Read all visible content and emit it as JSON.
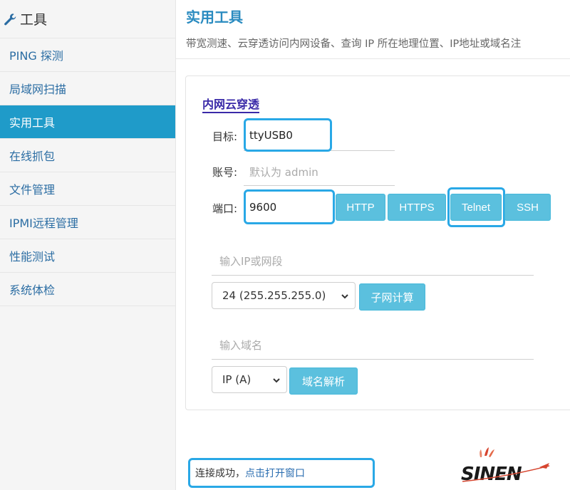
{
  "sidebar": {
    "header": "工具",
    "items": [
      {
        "label": "PING 探测"
      },
      {
        "label": "局域网扫描"
      },
      {
        "label": "实用工具"
      },
      {
        "label": "在线抓包"
      },
      {
        "label": "文件管理"
      },
      {
        "label": "IPMI远程管理"
      },
      {
        "label": "性能测试"
      },
      {
        "label": "系统体检"
      }
    ],
    "active_index": 2
  },
  "page": {
    "title": "实用工具",
    "description": "带宽测速、云穿透访问内网设备、查询 IP 所在地理位置、IP地址或域名注"
  },
  "tunnel": {
    "section_title": "内网云穿透",
    "target_label": "目标:",
    "target_value": "ttyUSB0",
    "account_label": "账号:",
    "account_placeholder": "默认为 admin",
    "port_label": "端口:",
    "port_value": "9600",
    "buttons": [
      "HTTP",
      "HTTPS",
      "Telnet",
      "SSH"
    ]
  },
  "subnet": {
    "ip_placeholder": "输入IP或网段",
    "mask_selected": "24 (255.255.255.0)",
    "calc_button": "子网计算"
  },
  "dns": {
    "domain_placeholder": "输入域名",
    "record_selected": "IP (A)",
    "resolve_button": "域名解析"
  },
  "status": {
    "text": "连接成功，",
    "link": "点击打开窗口"
  },
  "colors": {
    "accent": "#1f9bc9",
    "button": "#5bc0de",
    "highlight": "#29a8e6",
    "section_title": "#3a2aa8"
  }
}
